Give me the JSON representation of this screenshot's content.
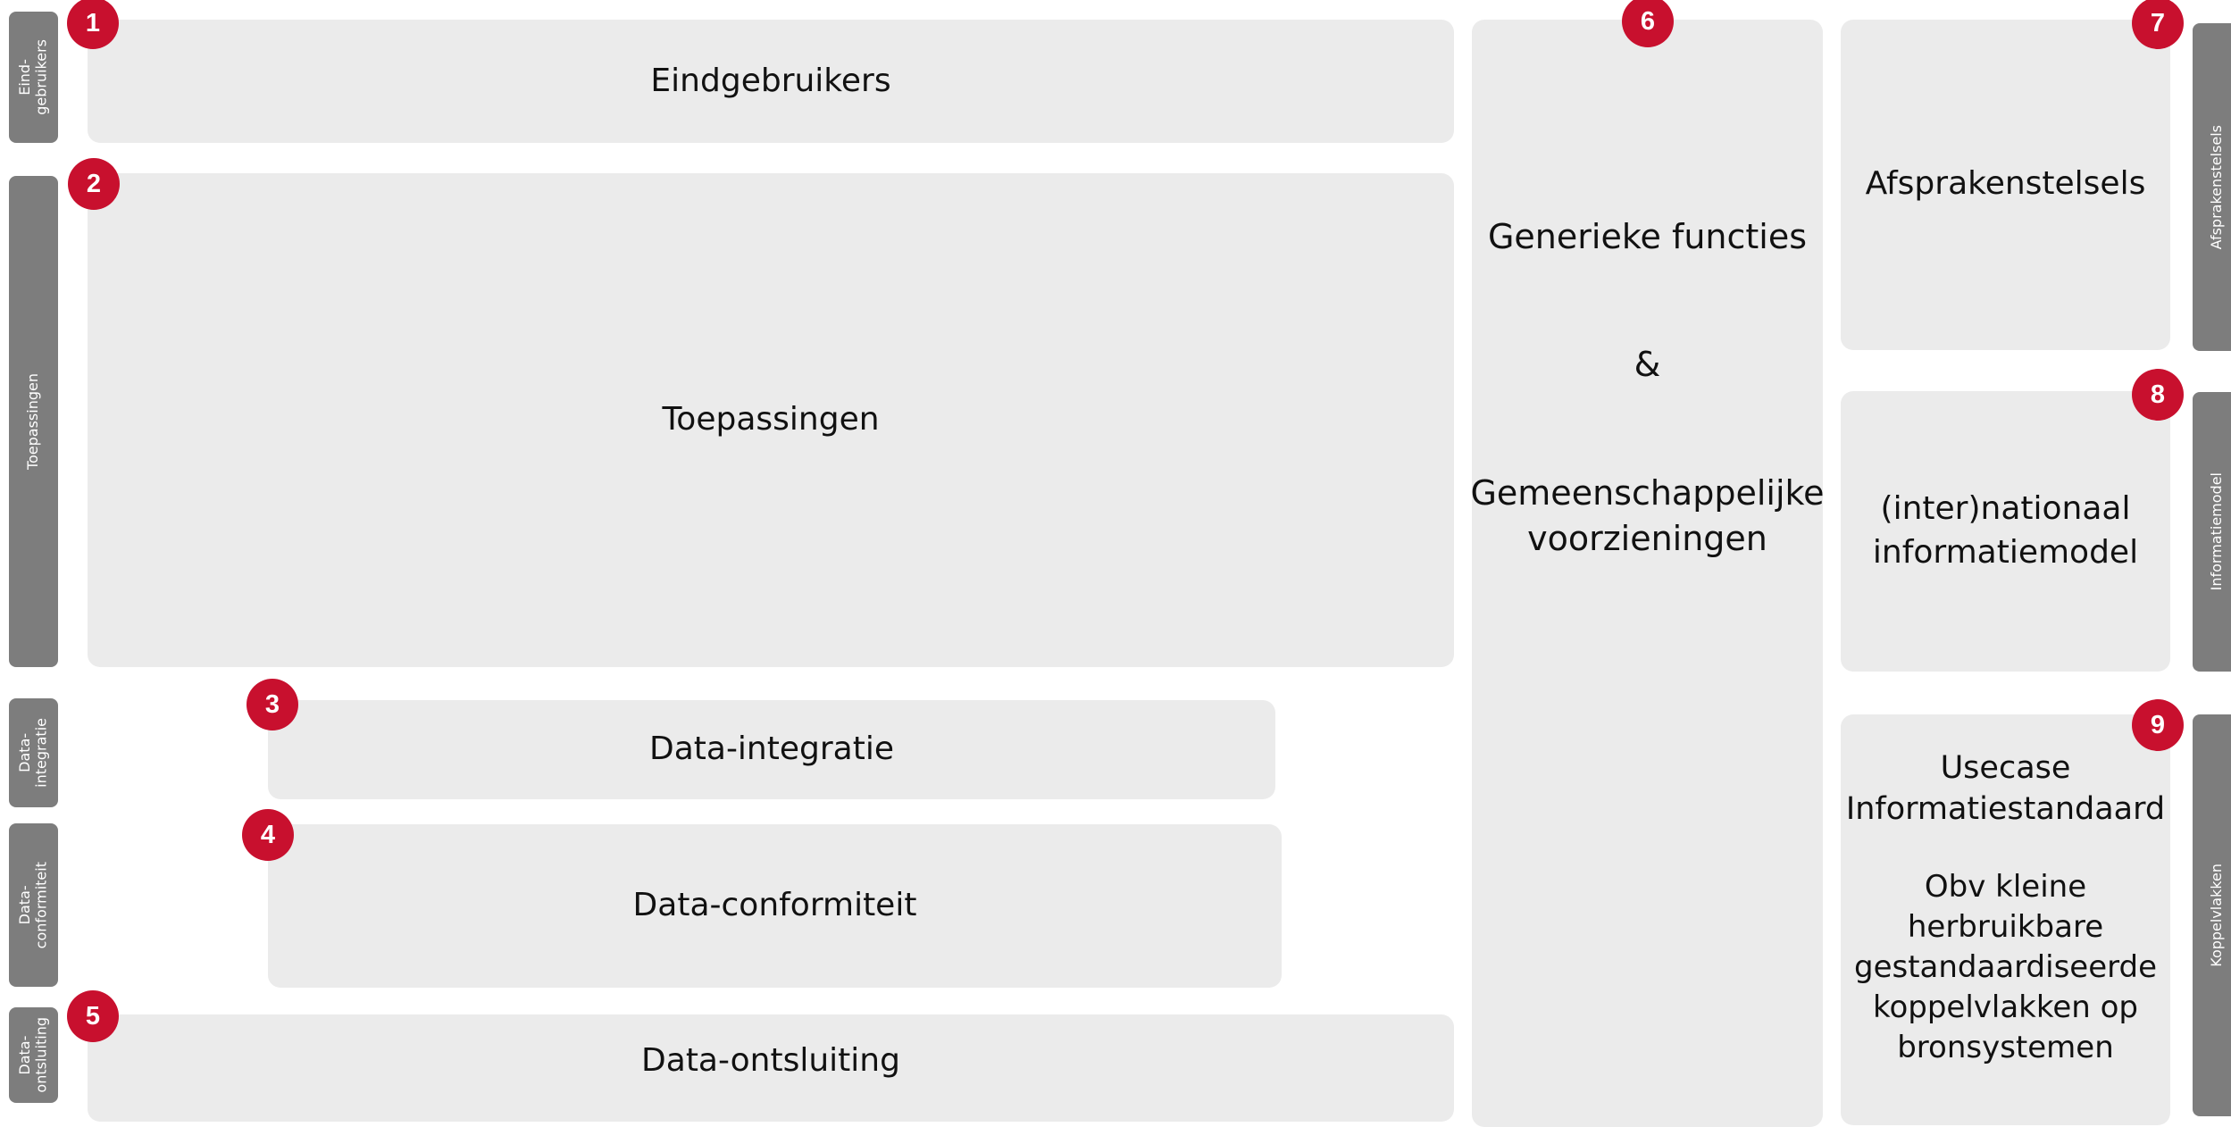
{
  "layers": {
    "eindgebruikers": {
      "number": "1",
      "label": "Eindgebruikers",
      "side_label": "Eind-\ngebruikers"
    },
    "toepassingen": {
      "number": "2",
      "label": "Toepassingen",
      "side_label": "Toepassingen"
    },
    "data_integratie": {
      "number": "3",
      "label": "Data-integratie",
      "side_label": "Data-\nintegratie"
    },
    "data_conformiteit": {
      "number": "4",
      "label": "Data-conformiteit",
      "side_label": "Data-\nconformiteit"
    },
    "data_ontsluiting": {
      "number": "5",
      "label": "Data-ontsluiting",
      "side_label": "Data-\nontsluiting"
    }
  },
  "generieke": {
    "number": "6",
    "line1": "Generieke functies",
    "amp": "&",
    "line2": "Gemeenschappelijke\nvoorzieningen"
  },
  "afsprakenstelsels": {
    "number": "7",
    "label": "Afsprakenstelsels",
    "side_label": "Afsprakenstelsels"
  },
  "informatiemodel": {
    "number": "8",
    "label": "(inter)nationaal\ninformatiemodel",
    "side_label": "Informatiemodel"
  },
  "koppelvlakken": {
    "number": "9",
    "title": "Usecase\nInformatiestandaard",
    "body": "Obv kleine\nherbruikbare\ngestandaardiseerde\nkoppelvlakken op\nbronsystemen",
    "side_label": "Koppelvlakken"
  },
  "colors": {
    "badge": "#c8102e",
    "box": "#ebebeb",
    "side_tab": "#7d7d7d"
  }
}
